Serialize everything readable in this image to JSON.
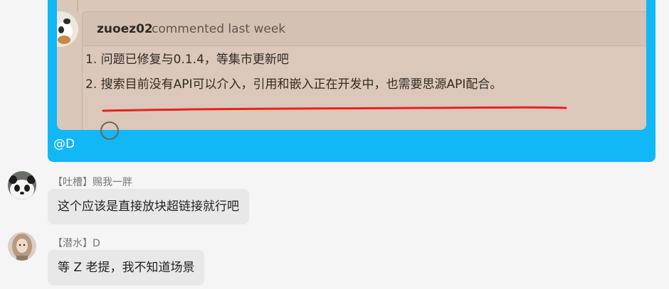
{
  "forwarded": {
    "comment_author": "zuoez02",
    "comment_meta": "commented last week",
    "items": [
      "1. 问题已修复与0.1.4，等集市更新吧",
      "2. 搜索目前没有API可以介入，引用和嵌入正在开发中，也需要思源API配合。"
    ],
    "mention": "@D"
  },
  "messages": [
    {
      "nick": "【吐槽】赐我一胖",
      "text": "这个应该是直接放块超链接就行吧",
      "avatar": "panda-avatar"
    },
    {
      "nick": "【潜水】D",
      "text": "等 Z 老提，我不知道场景",
      "avatar": "girl-avatar"
    }
  ],
  "colors": {
    "bubble_blue": "#12b7f5",
    "card_bg": "#dbc7b9",
    "highlight_red": "#e8221f",
    "gray_bubble": "#e8e8e8"
  }
}
